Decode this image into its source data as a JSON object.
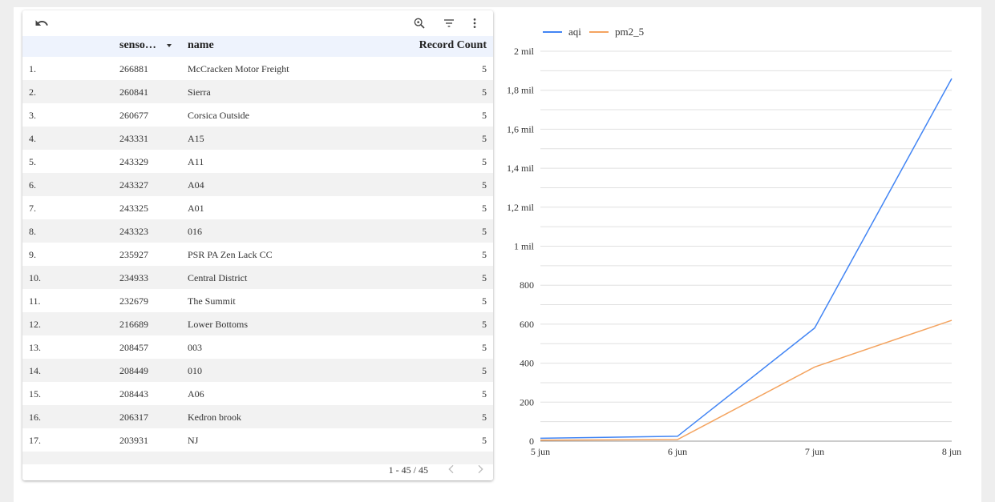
{
  "toolbar": {
    "undo_icon": "undo-icon",
    "zoom_icon": "zoom-search-icon",
    "filter_icon": "filter-icon",
    "more_icon": "more-vertical-icon"
  },
  "table": {
    "columns": [
      "senso…",
      "name",
      "Record Count"
    ],
    "rows": [
      {
        "idx": "1.",
        "sensor": "266881",
        "name": "McCracken Motor Freight",
        "count": "5"
      },
      {
        "idx": "2.",
        "sensor": "260841",
        "name": "Sierra",
        "count": "5"
      },
      {
        "idx": "3.",
        "sensor": "260677",
        "name": "Corsica Outside",
        "count": "5"
      },
      {
        "idx": "4.",
        "sensor": "243331",
        "name": "A15",
        "count": "5"
      },
      {
        "idx": "5.",
        "sensor": "243329",
        "name": "A11",
        "count": "5"
      },
      {
        "idx": "6.",
        "sensor": "243327",
        "name": "A04",
        "count": "5"
      },
      {
        "idx": "7.",
        "sensor": "243325",
        "name": "A01",
        "count": "5"
      },
      {
        "idx": "8.",
        "sensor": "243323",
        "name": "016",
        "count": "5"
      },
      {
        "idx": "9.",
        "sensor": "235927",
        "name": "PSR PA Zen Lack CC",
        "count": "5"
      },
      {
        "idx": "10.",
        "sensor": "234933",
        "name": "Central District",
        "count": "5"
      },
      {
        "idx": "11.",
        "sensor": "232679",
        "name": "The Summit",
        "count": "5"
      },
      {
        "idx": "12.",
        "sensor": "216689",
        "name": "Lower Bottoms",
        "count": "5"
      },
      {
        "idx": "13.",
        "sensor": "208457",
        "name": "003",
        "count": "5"
      },
      {
        "idx": "14.",
        "sensor": "208449",
        "name": "010",
        "count": "5"
      },
      {
        "idx": "15.",
        "sensor": "208443",
        "name": "A06",
        "count": "5"
      },
      {
        "idx": "16.",
        "sensor": "206317",
        "name": "Kedron brook",
        "count": "5"
      },
      {
        "idx": "17.",
        "sensor": "203931",
        "name": "NJ",
        "count": "5"
      }
    ],
    "pagination": "1 - 45 / 45"
  },
  "chart_data": {
    "type": "line",
    "x": [
      "5 jun",
      "6 jun",
      "7 jun",
      "8 jun"
    ],
    "series": [
      {
        "name": "aqi",
        "values": [
          15,
          25,
          580,
          1860
        ],
        "color": "#4285f4"
      },
      {
        "name": "pm2_5",
        "values": [
          5,
          8,
          380,
          620
        ],
        "color": "#f4a460"
      }
    ],
    "yticks": [
      "0",
      "200",
      "400",
      "600",
      "800",
      "1 mil",
      "1,2 mil",
      "1,4 mil",
      "1,6 mil",
      "1,8 mil",
      "2 mil"
    ],
    "ylim": [
      0,
      2000
    ],
    "grid": true,
    "legend_position": "top-left"
  }
}
